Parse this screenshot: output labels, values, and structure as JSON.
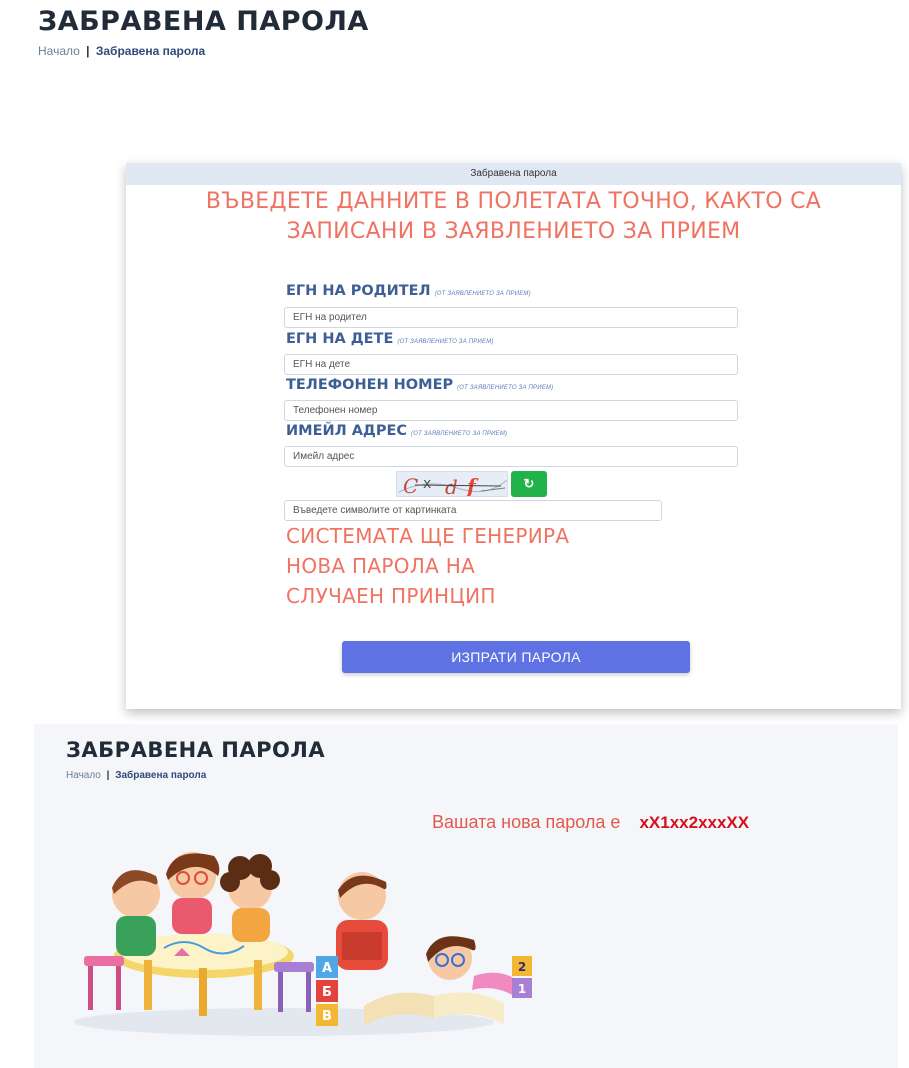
{
  "header": {
    "title": "ЗАБРАВЕНА ПАРОЛА",
    "breadcrumb_home": "Начало",
    "breadcrumb_separator": "|",
    "breadcrumb_current": "Забравена парола"
  },
  "form_card": {
    "header_title": "Забравена парола",
    "warning_line1": "ВЪВЕДЕТЕ ДАННИТЕ В ПОЛЕТАТА ТОЧНО, КАКТО СА",
    "warning_line2": "ЗАПИСАНИ В ЗАЯВЛЕНИЕТО ЗА ПРИЕМ",
    "fields": [
      {
        "label": "ЕГН НА РОДИТЕЛ",
        "hint": "(ОТ ЗАЯВЛЕНИЕТО ЗА ПРИЕМ)",
        "placeholder": "ЕГН на родител"
      },
      {
        "label": "ЕГН НА ДЕТЕ",
        "hint": "(ОТ ЗАЯВЛЕНИЕТО ЗА ПРИЕМ)",
        "placeholder": "ЕГН на дете"
      },
      {
        "label": "ТЕЛЕФОНЕН НОМЕР",
        "hint": "(ОТ ЗАЯВЛЕНИЕТО ЗА ПРИЕМ)",
        "placeholder": "Телефонен номер"
      },
      {
        "label": "ИМЕЙЛ АДРЕС",
        "hint": "(ОТ ЗАЯВЛЕНИЕТО ЗА ПРИЕМ)",
        "placeholder": "Имейл адрес"
      }
    ],
    "captcha": {
      "text": "C x d f",
      "refresh_icon": "refresh-icon",
      "placeholder": "Въведете символите от картинката"
    },
    "system_note_line1": "СИСТЕМАТА ЩЕ ГЕНЕРИРА",
    "system_note_line2": "НОВА ПАРОЛА НА",
    "system_note_line3": "СЛУЧАЕН ПРИНЦИП",
    "submit_label": "ИЗПРАТИ ПАРОЛА"
  },
  "result": {
    "title": "ЗАБРАВЕНА ПАРОЛА",
    "breadcrumb_home": "Начало",
    "breadcrumb_separator": "|",
    "breadcrumb_current": "Забравена парола",
    "new_password_label": "Вашата нова парола е",
    "new_password_value": "xX1xx2xxxXX",
    "blocks": [
      "А",
      "Б",
      "В"
    ],
    "number_blocks": [
      "2",
      "1"
    ]
  },
  "colors": {
    "accent_blue": "#5e72e4",
    "warning_salmon": "#f07261",
    "refresh_green": "#21b34a",
    "password_red": "#d4111b",
    "label_blue": "#3d5f95"
  }
}
